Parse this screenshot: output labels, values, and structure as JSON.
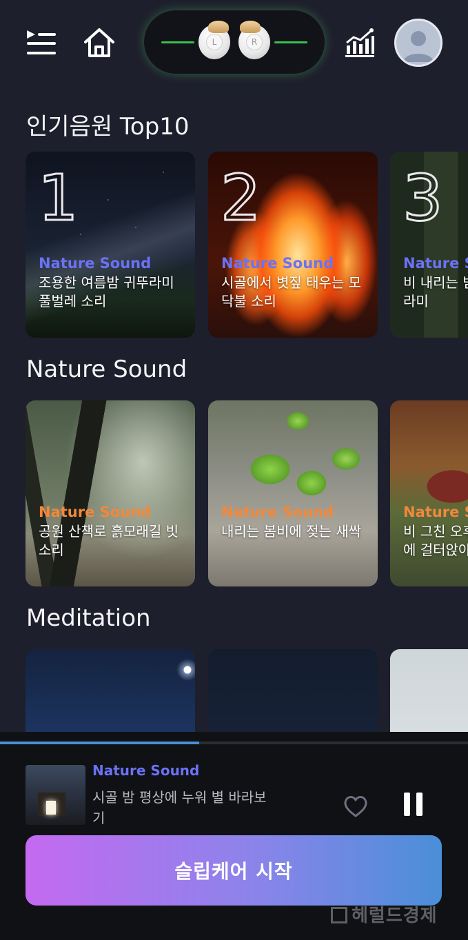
{
  "topbar": {
    "icons": [
      "playlist-icon",
      "home-icon",
      "stats-icon",
      "avatar-icon"
    ],
    "earbuds": {
      "left_label": "L",
      "right_label": "R",
      "status_color": "#38c24e"
    }
  },
  "sections": [
    {
      "title": "인기음원 Top10",
      "cards": [
        {
          "rank": "1",
          "category": "Nature Sound",
          "title": "조용한 여름밤 귀뚜라미 풀벌레 소리",
          "category_color": "#6b72f5"
        },
        {
          "rank": "2",
          "category": "Nature Sound",
          "title": "시골에서 볏짚 태우는 모닥불 소리",
          "category_color": "#6b72f5"
        },
        {
          "rank": "3",
          "category": "Nature Sound",
          "title": "비 내리는 밤 풀벌레 귀뚜라미",
          "category_color": "#6b72f5"
        }
      ]
    },
    {
      "title": "Nature Sound",
      "cards": [
        {
          "category": "Nature Sound",
          "title": "공원 산책로 흙모래길 빗소리",
          "category_color": "#f2883a"
        },
        {
          "category": "Nature Sound",
          "title": "내리는 봄비에 젖는 새싹",
          "category_color": "#f2883a"
        },
        {
          "category": "Nature Sound",
          "title": "비 그친 오후 시골집 마루에 걸터앉아",
          "category_color": "#f2883a"
        }
      ]
    },
    {
      "title": "Meditation",
      "cards": [
        {},
        {},
        {}
      ]
    }
  ],
  "player": {
    "category": "Nature Sound",
    "title": "시골 밤 평상에 누워 별 바라보기",
    "progress": 0.425,
    "liked": false,
    "state": "playing",
    "accent": "#4a8fd8"
  },
  "cta": {
    "label": "슬립케어 시작"
  },
  "watermark": {
    "text": "헤럴드경제"
  }
}
